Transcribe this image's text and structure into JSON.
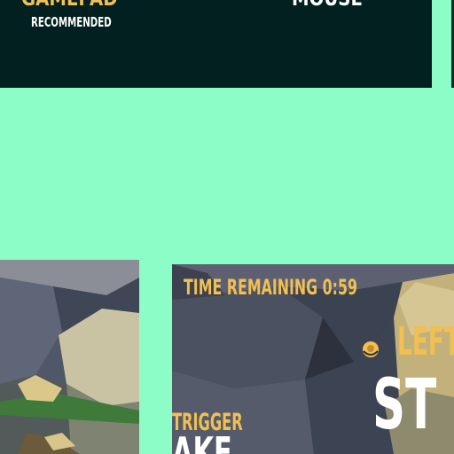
{
  "controller_options": {
    "gamepad": {
      "title": "GAMEPAD",
      "subtitle": "RECOMMENDED"
    },
    "mouse": {
      "title": "MOUSE"
    }
  },
  "preview": {
    "time_remaining": "TIME REMAINING 0:59",
    "lefty": "LEFT",
    "big_text": "ST",
    "trigger_label": "TRIGGER",
    "action_label": "AKE"
  },
  "colors": {
    "background": "#8cfdc6",
    "panel": "#02201f",
    "accent": "#f2bf55",
    "text": "#ffffff"
  },
  "icons": [
    "rock-scene-image",
    "thumbstick-icon"
  ]
}
